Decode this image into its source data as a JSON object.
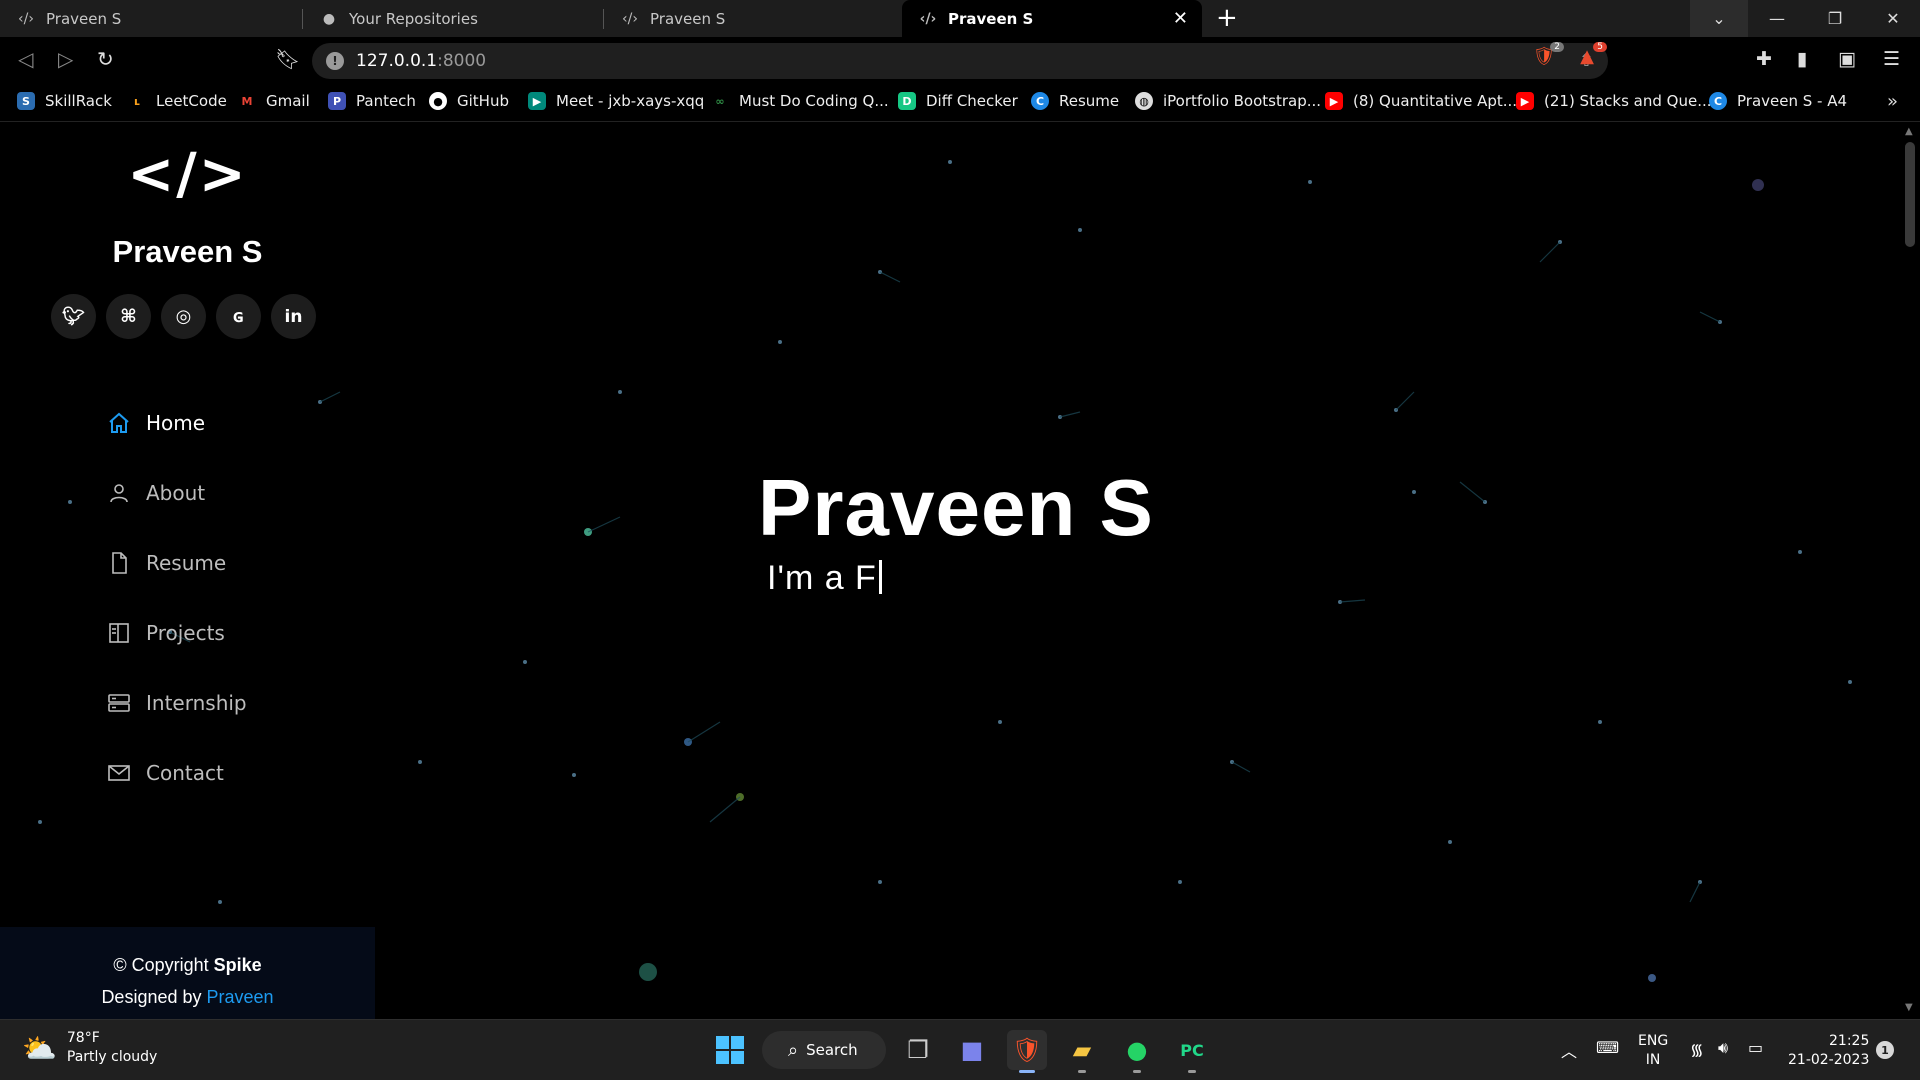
{
  "browser": {
    "tabs": [
      {
        "title": "Praveen S",
        "icon": "code-icon",
        "active": false
      },
      {
        "title": "Your Repositories",
        "icon": "github-icon",
        "active": false
      },
      {
        "title": "Praveen S",
        "icon": "code-icon",
        "active": false
      },
      {
        "title": "Praveen S",
        "icon": "code-icon",
        "active": true
      }
    ],
    "url_host": "127.0.0.1",
    "url_port": ":8000",
    "shield_badge": "2",
    "rewards_badge": "5",
    "bookmarks": [
      {
        "label": "SkillRack",
        "icon": "skillrack-icon",
        "color": "#2b6cb0"
      },
      {
        "label": "LeetCode",
        "icon": "leetcode-icon",
        "color": "#f89f1b"
      },
      {
        "label": "Gmail",
        "icon": "gmail-icon",
        "color": "#ea4335"
      },
      {
        "label": "Pantech",
        "icon": "pantech-icon",
        "color": "#3f51b5"
      },
      {
        "label": "GitHub",
        "icon": "github-icon",
        "color": "#ffffff"
      },
      {
        "label": "Meet - jxb-xays-xqq",
        "icon": "meet-icon",
        "color": "#00897b"
      },
      {
        "label": "Must Do Coding Q...",
        "icon": "gfg-icon",
        "color": "#2f8d46"
      },
      {
        "label": "Diff Checker",
        "icon": "diffchecker-icon",
        "color": "#16c784"
      },
      {
        "label": "Resume",
        "icon": "canva-icon",
        "color": "#1e88e5"
      },
      {
        "label": "iPortfolio Bootstrap...",
        "icon": "globe-icon",
        "color": "#dddddd"
      },
      {
        "label": "(8) Quantitative Apt...",
        "icon": "youtube-icon",
        "color": "#ff0000"
      },
      {
        "label": "(21) Stacks and Que...",
        "icon": "youtube-icon",
        "color": "#ff0000"
      },
      {
        "label": "Praveen S - A4",
        "icon": "canva-icon",
        "color": "#1e88e5"
      }
    ]
  },
  "page": {
    "logo": "</>",
    "name": "Praveen S",
    "socials": [
      {
        "icon": "twitter-icon",
        "glyph": "🐦"
      },
      {
        "icon": "github-icon",
        "glyph": "⌥"
      },
      {
        "icon": "instagram-icon",
        "glyph": "◎"
      },
      {
        "icon": "geeksforgeeks-icon",
        "glyph": "G"
      },
      {
        "icon": "linkedin-icon",
        "glyph": "in"
      }
    ],
    "nav": [
      {
        "label": "Home",
        "icon": "home-icon",
        "active": true
      },
      {
        "label": "About",
        "icon": "person-icon",
        "active": false
      },
      {
        "label": "Resume",
        "icon": "file-icon",
        "active": false
      },
      {
        "label": "Projects",
        "icon": "book-icon",
        "active": false
      },
      {
        "label": "Internship",
        "icon": "server-icon",
        "active": false
      },
      {
        "label": "Contact",
        "icon": "envelope-icon",
        "active": false
      }
    ],
    "footer": {
      "copyright_prefix": "© Copyright ",
      "copyright_brand": "Spike",
      "designed_prefix": "Designed by ",
      "designer": "Praveen"
    },
    "hero": {
      "title": "Praveen S",
      "typed": "I'm a F"
    },
    "accent_color": "#1d9bf0"
  },
  "taskbar": {
    "weather_temp": "78°F",
    "weather_desc": "Partly cloudy",
    "search_label": "Search",
    "lang_line1": "ENG",
    "lang_line2": "IN",
    "time": "21:25",
    "date": "21-02-2023",
    "notification_count": "1"
  }
}
